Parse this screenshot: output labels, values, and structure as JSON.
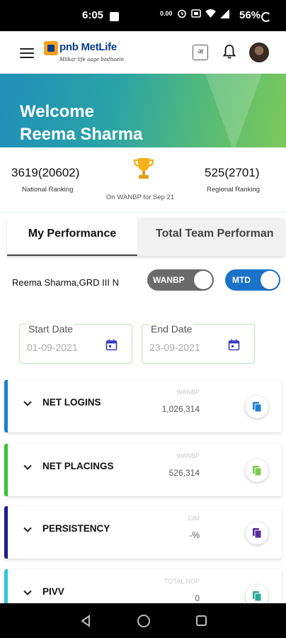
{
  "status_bar": {
    "time": "6:05",
    "data_rate": "0.00",
    "battery": "56%"
  },
  "header": {
    "logo": {
      "brand": "pnb MetLife",
      "tagline": "Milkar life aage badhaein"
    },
    "language_label": "अ"
  },
  "banner": {
    "line1": "Welcome",
    "line2": "Reema Sharma"
  },
  "ranking": {
    "national_value": "3619(20602)",
    "national_label": "National Ranking",
    "regional_value": "525(2701)",
    "regional_label": "Regional Ranking",
    "period_label": "On WANBP for Sep 21"
  },
  "tabs": [
    {
      "label": "My Performance",
      "active": true
    },
    {
      "label": "Total Team Performan",
      "active": false
    }
  ],
  "filters": {
    "agent": "Reema Sharma,GRD III N",
    "toggle_basis": "WANBP",
    "toggle_period": "MTD"
  },
  "dates": {
    "start_label": "Start Date",
    "start_value": "01-09-2021",
    "end_label": "End Date",
    "end_value": "23-09-2021"
  },
  "metrics": [
    {
      "name": "NET LOGINS",
      "key": "WANBP",
      "value": "1,026,314",
      "color": "#1e7fd6"
    },
    {
      "name": "NET PLACINGS",
      "key": "WANBP",
      "value": "526,314",
      "color": "#39c234"
    },
    {
      "name": "PERSISTENCY",
      "key": "13M",
      "value": "-%",
      "color": "#1b1f8c"
    },
    {
      "name": "PIVV",
      "key": "TOTAL NOP",
      "value": "0",
      "color": "#2ec6d8"
    }
  ],
  "colors": {
    "brand_blue": "#0b3d8c",
    "brand_orange": "#f5a11c",
    "toggle_on": "#1a73c9",
    "toggle_off": "#6a6a6a"
  },
  "icons": [
    "menu-icon",
    "language-icon",
    "bell-icon",
    "avatar",
    "trophy-icon",
    "calendar-icon",
    "chevron-down-icon",
    "copy-icon",
    "back-icon",
    "home-icon",
    "recents-icon"
  ]
}
